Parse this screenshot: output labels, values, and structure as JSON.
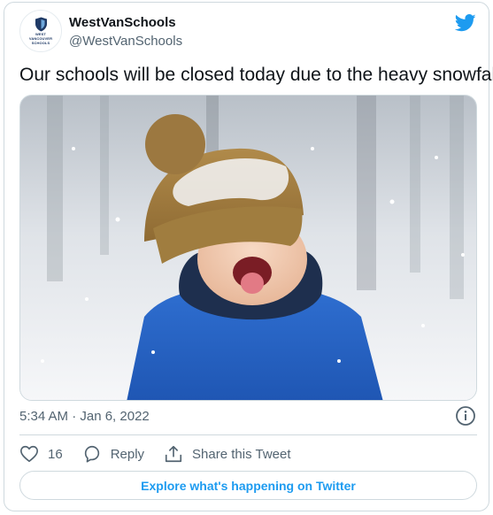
{
  "tweet": {
    "author_name": "WestVanSchools",
    "author_handle": "@WestVanSchools",
    "avatar_text_line1": "WEST",
    "avatar_text_line2": "VANCOUVER",
    "avatar_text_line3": "SCHOOLS",
    "text": "Our schools will be closed today due to the heavy snowfall",
    "timestamp": "5:34 AM · Jan 6, 2022",
    "like_count": "16",
    "reply_label": "Reply",
    "share_label": "Share this Tweet",
    "explore_label": "Explore what's happening on Twitter",
    "photo_alt": ""
  },
  "colors": {
    "brand_blue": "#1d9bf0",
    "text_primary": "#0f1419",
    "text_secondary": "#536471",
    "border": "#cfd9de"
  },
  "icons": {
    "logo": "twitter-bird-icon",
    "info": "info-icon",
    "like": "heart-icon",
    "reply": "speech-bubble-icon",
    "share": "share-icon"
  }
}
